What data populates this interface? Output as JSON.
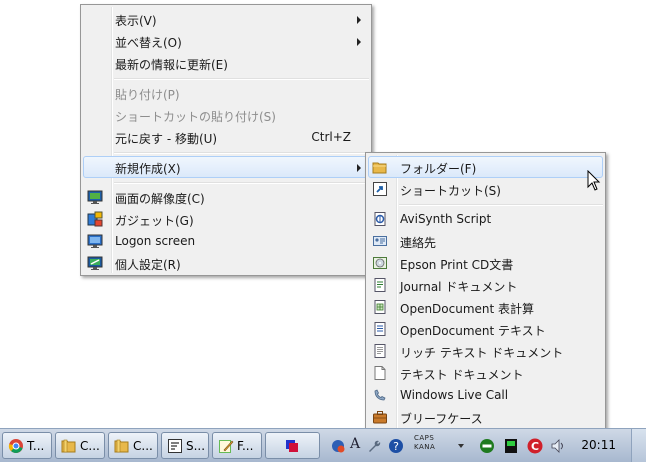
{
  "context_menu": {
    "items": [
      {
        "label": "表示(V)",
        "submenu": true
      },
      {
        "label": "並べ替え(O)",
        "submenu": true
      },
      {
        "label": "最新の情報に更新(E)"
      },
      {
        "label": "貼り付け(P)",
        "disabled": true
      },
      {
        "label": "ショートカットの貼り付け(S)",
        "disabled": true
      },
      {
        "label": "元に戻す - 移動(U)",
        "shortcut": "Ctrl+Z"
      },
      {
        "label": "新規作成(X)",
        "submenu": true,
        "highlighted": true
      },
      {
        "label": "画面の解像度(C)",
        "icon": "monitor-icon"
      },
      {
        "label": "ガジェット(G)",
        "icon": "gadget-icon"
      },
      {
        "label": "Logon screen",
        "icon": "logon-screen-icon"
      },
      {
        "label": "個人設定(R)",
        "icon": "personalize-icon"
      }
    ]
  },
  "new_submenu": {
    "items": [
      {
        "label": "フォルダー(F)",
        "icon": "folder-icon",
        "highlighted": true
      },
      {
        "label": "ショートカット(S)",
        "icon": "shortcut-icon"
      },
      {
        "label": "AviSynth Script",
        "icon": "avisynth-icon"
      },
      {
        "label": "連絡先",
        "icon": "contact-icon"
      },
      {
        "label": "Epson Print CD文書",
        "icon": "epson-print-cd-icon"
      },
      {
        "label": "Journal ドキュメント",
        "icon": "journal-icon"
      },
      {
        "label": "OpenDocument 表計算",
        "icon": "spreadsheet-icon"
      },
      {
        "label": "OpenDocument テキスト",
        "icon": "odt-icon"
      },
      {
        "label": "リッチ テキスト ドキュメント",
        "icon": "rtf-icon"
      },
      {
        "label": "テキスト ドキュメント",
        "icon": "text-document-icon"
      },
      {
        "label": "Windows Live Call",
        "icon": "live-call-icon"
      },
      {
        "label": "ブリーフケース",
        "icon": "briefcase-icon"
      }
    ]
  },
  "taskbar": {
    "buttons": [
      {
        "label": "T...",
        "icon": "chrome-icon"
      },
      {
        "label": "C...",
        "icon": "folder-icon"
      },
      {
        "label": "C...",
        "icon": "folder-icon"
      },
      {
        "label": "S...",
        "icon": "app-icon"
      },
      {
        "label": "F...",
        "icon": "editor-icon"
      },
      {
        "label": "",
        "icon": "window-icon"
      }
    ],
    "tray": {
      "ime_top": "CAPS",
      "ime_bottom": "KANA",
      "clock": "20:11"
    }
  },
  "colors": {
    "menu_bg": "#f0f0f0",
    "highlight_bg": "#dbe9fa",
    "highlight_border": "#aecff7",
    "disabled_text": "#8d8d8d"
  }
}
